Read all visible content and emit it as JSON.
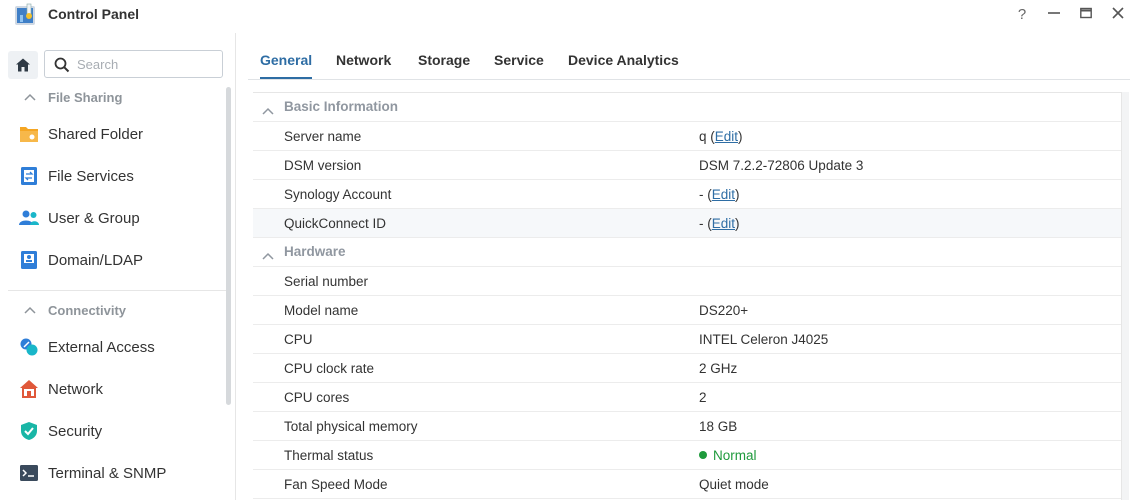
{
  "window": {
    "title": "Control Panel",
    "controls": {
      "help": "?",
      "minimize": "—",
      "maximize": "▭",
      "close": "✕"
    }
  },
  "sidebar": {
    "search_placeholder": "Search",
    "sections": [
      {
        "title": "File Sharing",
        "items": [
          {
            "label": "Shared Folder",
            "icon": "shared-folder-icon"
          },
          {
            "label": "File Services",
            "icon": "file-services-icon"
          },
          {
            "label": "User & Group",
            "icon": "user-group-icon"
          },
          {
            "label": "Domain/LDAP",
            "icon": "domain-ldap-icon"
          }
        ]
      },
      {
        "title": "Connectivity",
        "items": [
          {
            "label": "External Access",
            "icon": "external-access-icon"
          },
          {
            "label": "Network",
            "icon": "network-icon"
          },
          {
            "label": "Security",
            "icon": "security-icon"
          },
          {
            "label": "Terminal & SNMP",
            "icon": "terminal-icon"
          }
        ]
      }
    ]
  },
  "tabs": [
    {
      "label": "General",
      "active": true
    },
    {
      "label": "Network",
      "active": false
    },
    {
      "label": "Storage",
      "active": false
    },
    {
      "label": "Service",
      "active": false
    },
    {
      "label": "Device Analytics",
      "active": false
    }
  ],
  "basic_info": {
    "title": "Basic Information",
    "server_name": {
      "label": "Server name",
      "value": "q",
      "edit": "Edit"
    },
    "dsm_version": {
      "label": "DSM version",
      "value": "DSM 7.2.2-72806 Update 3"
    },
    "synology_account": {
      "label": "Synology Account",
      "value": "-",
      "edit": "Edit"
    },
    "quickconnect_id": {
      "label": "QuickConnect ID",
      "value": "-",
      "edit": "Edit"
    }
  },
  "hardware": {
    "title": "Hardware",
    "serial_number": {
      "label": "Serial number",
      "value": ""
    },
    "model_name": {
      "label": "Model name",
      "value": "DS220+"
    },
    "cpu": {
      "label": "CPU",
      "value": "INTEL Celeron J4025"
    },
    "cpu_clock": {
      "label": "CPU clock rate",
      "value": "2 GHz"
    },
    "cpu_cores": {
      "label": "CPU cores",
      "value": "2"
    },
    "memory": {
      "label": "Total physical memory",
      "value": "18 GB"
    },
    "thermal": {
      "label": "Thermal status",
      "value": "Normal",
      "color": "#1e9a3c"
    },
    "fan_mode": {
      "label": "Fan Speed Mode",
      "value": "Quiet mode"
    }
  },
  "colors": {
    "accent": "#2e6da4",
    "ok": "#1e9a3c"
  }
}
